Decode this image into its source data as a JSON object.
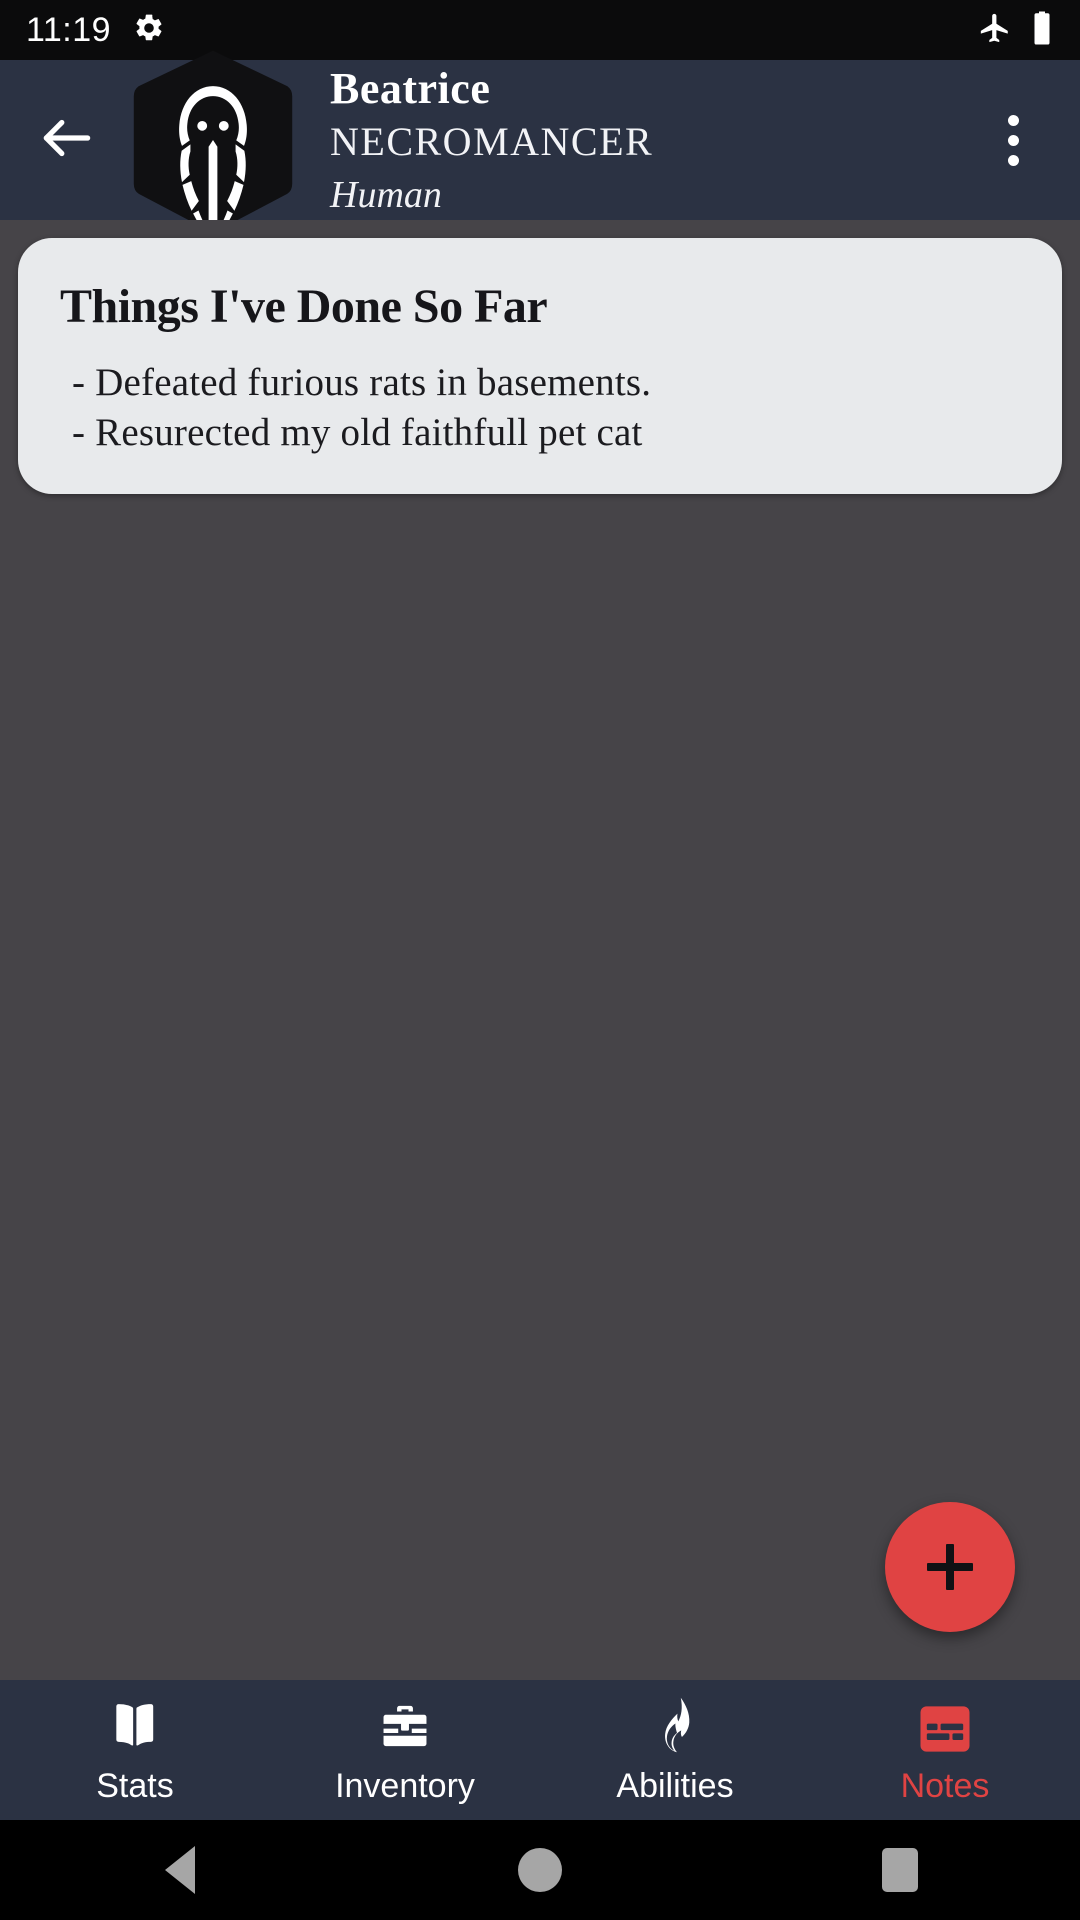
{
  "statusbar": {
    "time": "11:19",
    "icons": [
      "gear-icon",
      "airplane-mode-icon",
      "battery-icon"
    ]
  },
  "header": {
    "back_icon": "arrow-left-icon",
    "avatar_icon": "hooded-figure-avatar",
    "character_name": "Beatrice",
    "character_class": "NECROMANCER",
    "character_race": "Human",
    "overflow_icon": "more-vertical-icon"
  },
  "note_card": {
    "title": "Things I've Done So Far",
    "lines": [
      "- Defeated furious rats in basements.",
      "- Resurected my old faithfull pet cat"
    ]
  },
  "fab": {
    "label": "+",
    "icon": "plus-icon",
    "color": "#e04343"
  },
  "bottom_nav": {
    "active_color": "#e04343",
    "inactive_color": "#ffffff",
    "items": [
      {
        "label": "Stats",
        "icon": "open-book-icon",
        "active": false
      },
      {
        "label": "Inventory",
        "icon": "briefcase-icon",
        "active": false
      },
      {
        "label": "Abilities",
        "icon": "flame-icon",
        "active": false
      },
      {
        "label": "Notes",
        "icon": "notes-card-icon",
        "active": true
      }
    ]
  },
  "system_nav": {
    "back": "back-triangle-icon",
    "home": "home-circle-icon",
    "recents": "recents-square-icon"
  },
  "colors": {
    "appbar": "#2b3243",
    "page_background": "#464448",
    "card": "#e8eaec",
    "accent": "#e04343",
    "statusbar": "#0b0b0c"
  }
}
